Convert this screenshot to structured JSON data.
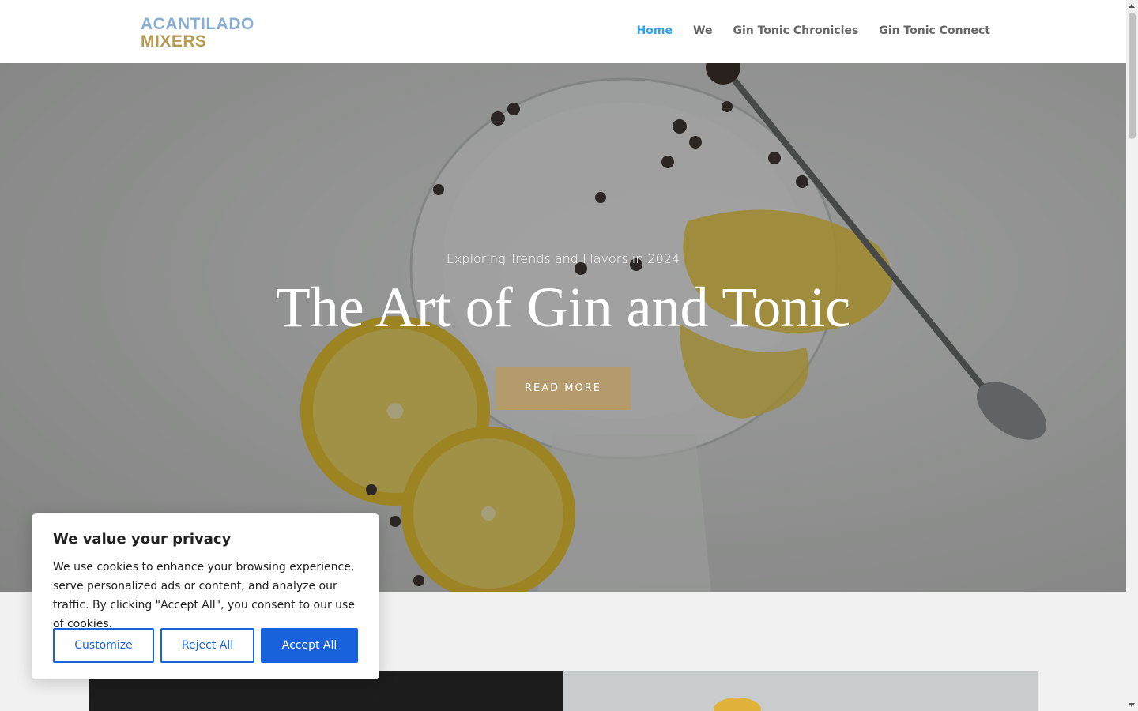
{
  "logo": {
    "line1": "ACANTILADO",
    "line2": "MIXERS"
  },
  "nav": {
    "items": [
      {
        "label": "Home",
        "active": true
      },
      {
        "label": "We",
        "active": false
      },
      {
        "label": "Gin Tonic Chronicles",
        "active": false
      },
      {
        "label": "Gin Tonic Connect",
        "active": false
      }
    ]
  },
  "hero": {
    "subtitle": "Exploring Trends and Flavors in 2024",
    "title": "The Art of Gin and Tonic",
    "button_label": "READ MORE"
  },
  "cookie": {
    "title": "We value your privacy",
    "body": "We use cookies to enhance your browsing experience, serve personalized ads or content, and analyze our traffic. By clicking \"Accept All\", you consent to our use of cookies.",
    "customize_label": "Customize",
    "reject_label": "Reject All",
    "accept_label": "Accept All"
  },
  "colors": {
    "accent": "#2ea3f2",
    "brand_blue": "#8aaed3",
    "brand_gold": "#b59a4f",
    "button_gold": "#b59a6b",
    "cookie_blue": "#1863dc"
  }
}
